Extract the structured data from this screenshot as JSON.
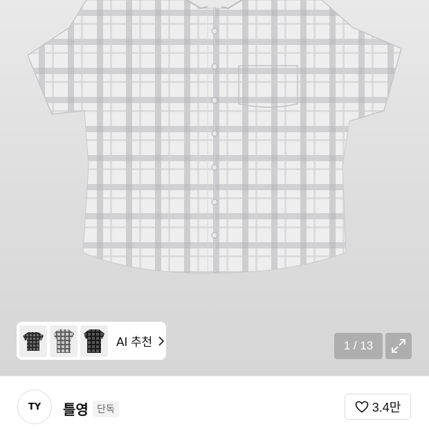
{
  "product": {
    "image_alt_icon": "plaid-shirt-image",
    "gallery": {
      "current": 1,
      "total": 13,
      "counter_text": "1 / 13"
    },
    "expand_icon": "expand-icon"
  },
  "ai_recommend": {
    "label": "AI 추천",
    "thumbnails": [
      "dark-check-shirt-thumb",
      "grey-check-shirt-thumb",
      "black-check-shirt-thumb"
    ],
    "chevron_icon": "chevron-right-icon"
  },
  "brand": {
    "logo_text": "TY",
    "name": "틀영",
    "badge": "단독"
  },
  "like": {
    "icon": "heart-icon",
    "count": "3.4만"
  },
  "colors": {
    "counter_bg": "#8c8c8c",
    "badge_bg": "#f3f3f3",
    "text": "#111111"
  }
}
